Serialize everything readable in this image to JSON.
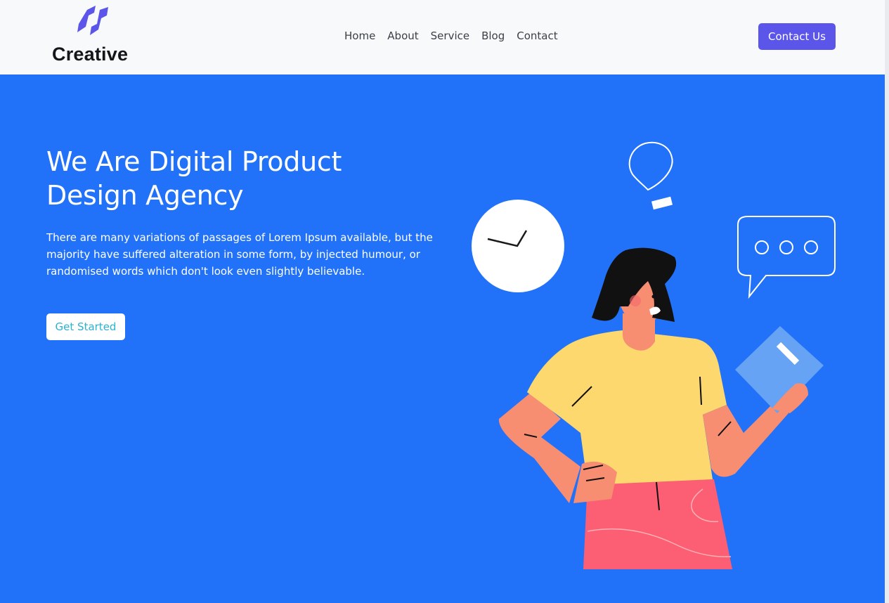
{
  "brand": {
    "name": "Creative",
    "icon": "creative-logo-icon"
  },
  "nav": {
    "items": [
      "Home",
      "About",
      "Service",
      "Blog",
      "Contact"
    ]
  },
  "header": {
    "cta_label": "Contact Us"
  },
  "hero": {
    "title_line1": "We Are Digital Product",
    "title_line2": "Design Agency",
    "description_line1": "There are many variations of passages of Lorem Ipsum available, but the",
    "description_line2": "majority have suffered alteration in some form, by injected humour, or",
    "description_line3": "randomised words which don't look even slightly believable.",
    "button_label": "Get Started"
  },
  "illustration": {
    "icons": [
      "clock-icon",
      "lightbulb-icon",
      "chat-bubble-icon",
      "book-icon"
    ]
  },
  "colors": {
    "header_bg": "#f8f9fb",
    "hero_bg": "#2272f9",
    "accent": "#5b55ea",
    "button_text": "#2ab3d2"
  }
}
